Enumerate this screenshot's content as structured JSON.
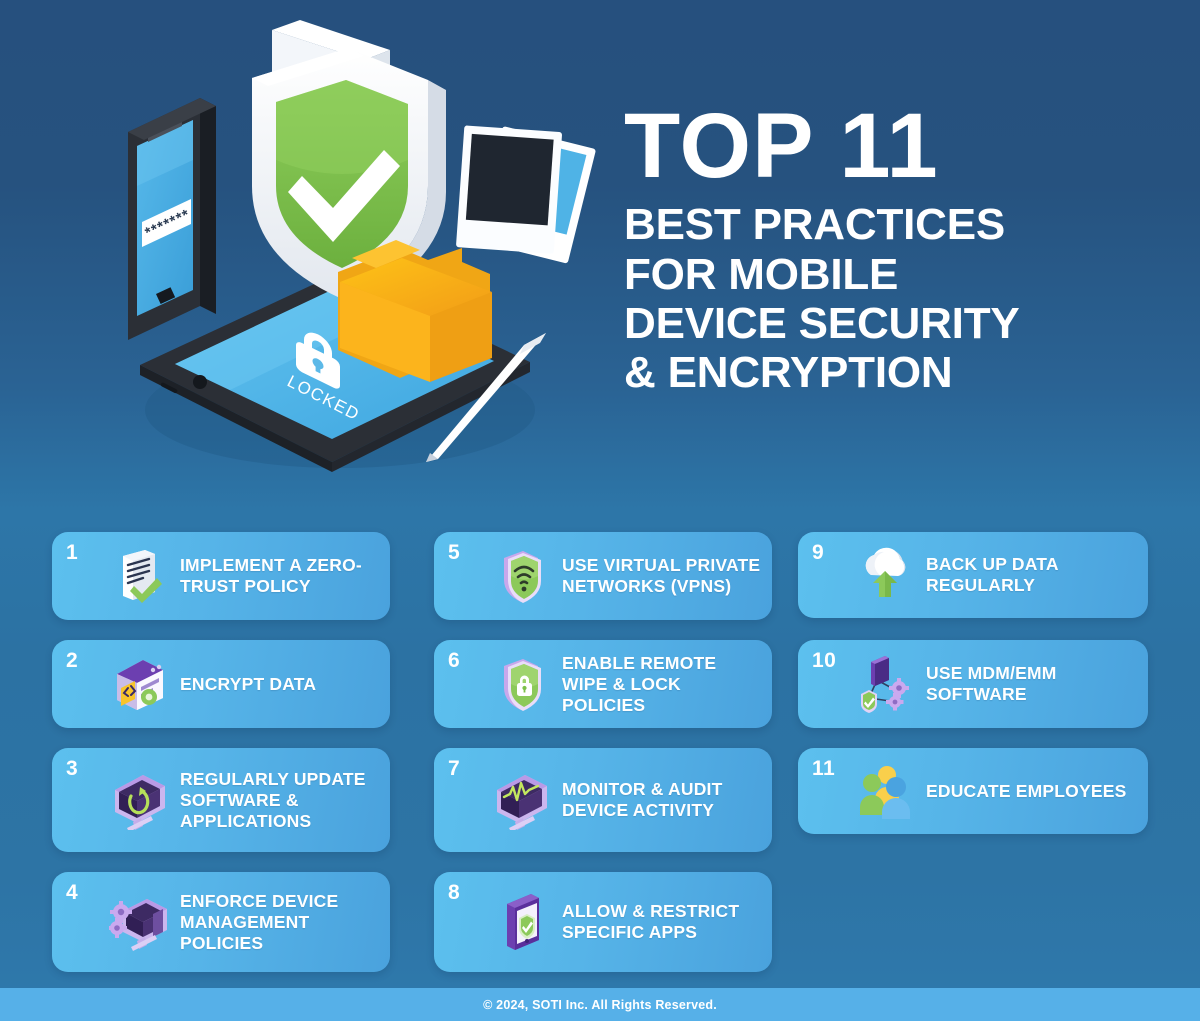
{
  "background": {
    "top_color": "#26507e",
    "mid_color": "#2d76a8",
    "bottom_color": "#2e78ab"
  },
  "hero": {
    "name": "mobile-device-security-illustration",
    "phone_password_mask": "*******",
    "tablet_label": "LOCKED",
    "shield_color": "#7cc24a",
    "folder_color": "#f9b417"
  },
  "headline": {
    "line1": "TOP 11",
    "line2": "BEST PRACTICES",
    "line3": "FOR MOBILE",
    "line4": "DEVICE SECURITY",
    "line5": "& ENCRYPTION",
    "color": "#ffffff"
  },
  "cards": {
    "accent_light": "#5cc0ee",
    "accent_dark": "#4aa2dd",
    "column1": [
      {
        "number": "1",
        "label": "IMPLEMENT A ZERO-TRUST POLICY",
        "icon": "document-check-icon"
      },
      {
        "number": "2",
        "label": "ENCRYPT DATA",
        "icon": "code-window-encryption-icon"
      },
      {
        "number": "3",
        "label": "REGULARLY UPDATE SOFTWARE & APPLICATIONS",
        "icon": "monitor-refresh-icon"
      },
      {
        "number": "4",
        "label": "ENFORCE DEVICE MANAGEMENT POLICIES",
        "icon": "monitor-gears-icon"
      }
    ],
    "column2": [
      {
        "number": "5",
        "label": "USE VIRTUAL PRIVATE NETWORKS (VPNS)",
        "icon": "shield-wifi-icon"
      },
      {
        "number": "6",
        "label": "ENABLE REMOTE WIPE & LOCK POLICIES",
        "icon": "shield-lock-icon"
      },
      {
        "number": "7",
        "label": "MONITOR & AUDIT DEVICE ACTIVITY",
        "icon": "monitor-pulse-icon"
      },
      {
        "number": "8",
        "label": "ALLOW & RESTRICT SPECIFIC APPS",
        "icon": "phone-shield-check-icon"
      }
    ],
    "column3": [
      {
        "number": "9",
        "label": "BACK UP DATA REGULARLY",
        "icon": "cloud-upload-icon"
      },
      {
        "number": "10",
        "label": "USE MDM/EMM SOFTWARE",
        "icon": "device-network-gears-icon"
      },
      {
        "number": "11",
        "label": "EDUCATE EMPLOYEES",
        "icon": "people-group-icon"
      }
    ]
  },
  "footer": {
    "copyright": "© 2024, SOTI Inc. All Rights Reserved.",
    "bar_color": "#56b0e8"
  }
}
